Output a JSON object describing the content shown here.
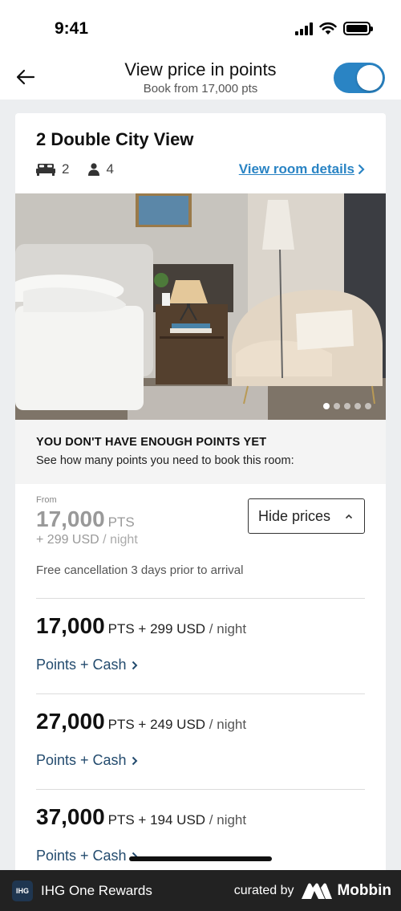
{
  "status_bar": {
    "time": "9:41"
  },
  "header": {
    "title": "View price in points",
    "subtitle": "Book from 17,000 pts",
    "toggle_on": true,
    "accent_color": "#2a84c4"
  },
  "room": {
    "name": "2 Double City View",
    "beds": "2",
    "guests": "4",
    "details_link": "View room details",
    "photo_count": 5,
    "photo_active_index": 0
  },
  "notice": {
    "title": "YOU DON'T HAVE ENOUGH POINTS YET",
    "text": "See how many points you need to book this room:"
  },
  "summary": {
    "from_label": "From",
    "points": "17,000",
    "points_unit": "PTS",
    "cash": "+ 299 USD",
    "cash_unit": "/ night",
    "hide_button": "Hide prices",
    "cancellation": "Free cancellation 3 days prior to arrival"
  },
  "options": [
    {
      "points": "17,000",
      "rest": "PTS + 299 USD",
      "unit": "/ night",
      "link": "Points + Cash"
    },
    {
      "points": "27,000",
      "rest": "PTS + 249 USD",
      "unit": "/ night",
      "link": "Points + Cash"
    },
    {
      "points": "37,000",
      "rest": "PTS + 194 USD",
      "unit": "/ night",
      "link": "Points + Cash"
    }
  ],
  "footer": {
    "app_logo": "IHG",
    "app_name": "IHG One Rewards",
    "curated": "curated by",
    "brand": "Mobbin"
  }
}
